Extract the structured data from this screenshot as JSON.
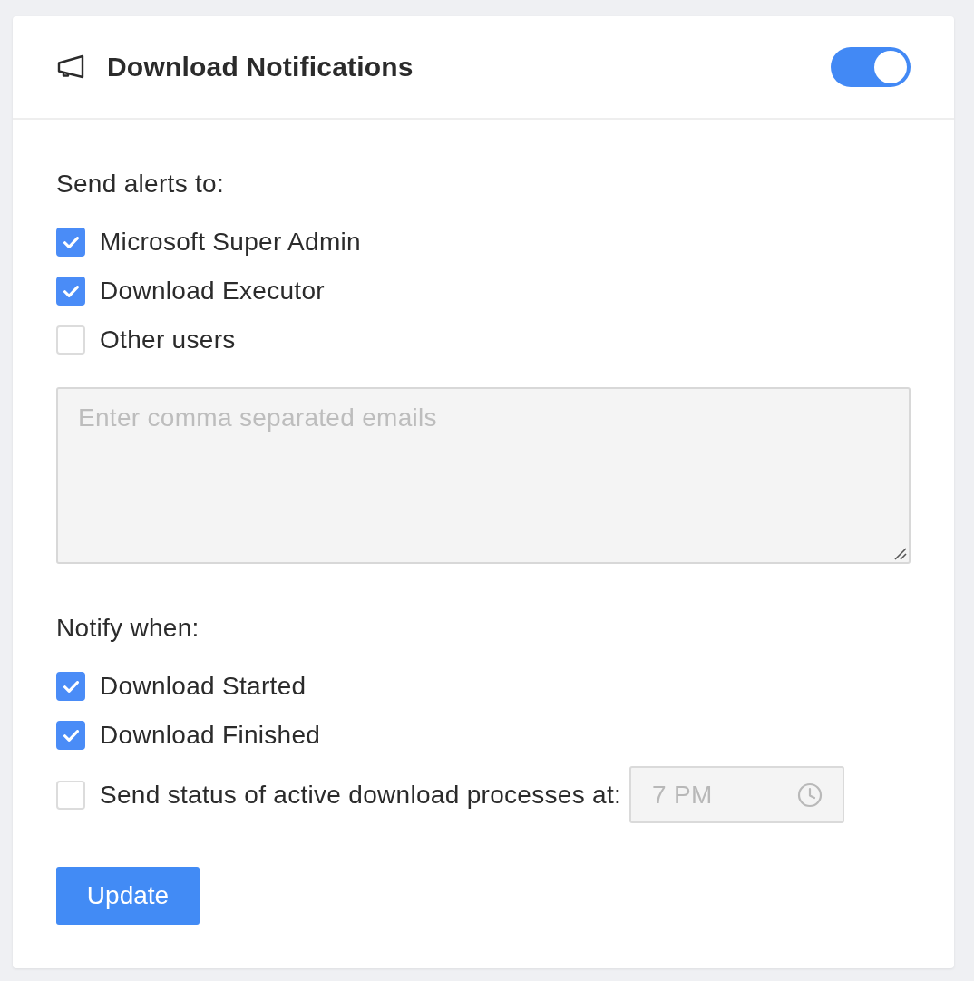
{
  "header": {
    "title": "Download Notifications",
    "enabled": true
  },
  "recipients": {
    "label": "Send alerts to:",
    "options": [
      {
        "label": "Microsoft Super Admin",
        "checked": true
      },
      {
        "label": "Download Executor",
        "checked": true
      },
      {
        "label": "Other users",
        "checked": false
      }
    ],
    "emails": {
      "placeholder": "Enter comma separated emails",
      "disabled": true
    }
  },
  "triggers": {
    "label": "Notify when:",
    "options": [
      {
        "kind": "plain",
        "label": "Download Started",
        "checked": true
      },
      {
        "kind": "plain",
        "label": "Download Finished",
        "checked": true
      },
      {
        "kind": "time",
        "label": "Send status of active download processes at:",
        "checked": false,
        "time": {
          "value": "7 PM",
          "disabled": true
        }
      }
    ]
  },
  "button": {
    "label": "Update"
  }
}
